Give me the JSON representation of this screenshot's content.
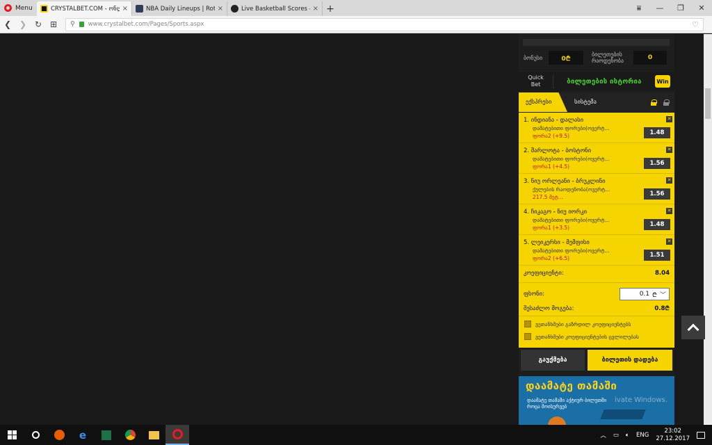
{
  "browser": {
    "menu_label": "Menu",
    "tabs": [
      {
        "title": "CRYSTALBET.COM - ონლაინ",
        "close": "×"
      },
      {
        "title": "NBA Daily Lineups | RotoWire",
        "close": "×"
      },
      {
        "title": "Live Basketball Scores - NBA",
        "close": "×"
      }
    ],
    "new_tab": "+",
    "url": "www.crystalbet.com/Pages/Sports.aspx"
  },
  "betslip": {
    "bonus_label": "ბონუსი",
    "bonus_value": "0₾",
    "tickets_label_1": "ბილეთების",
    "tickets_label_2": "რაოდენობა",
    "tickets_value": "0",
    "quick_bet_1": "Quick",
    "quick_bet_2": "Bet",
    "history_label": "ბილეთების ისტორია",
    "win_badge": "Win",
    "tab_express": "ექსპრესი",
    "tab_system": "სისტემა",
    "bets": [
      {
        "title": "1. ინდიანა - დალასი",
        "market": "დამატებითი ფორები(ოვერტ...",
        "pick": "ფორა2 (+9.5)",
        "odds": "1.48"
      },
      {
        "title": "2. შარლოტა - ბოსტონი",
        "market": "დამატებითი ფორები(ოვერტ...",
        "pick": "ფორა1 (+4.5)",
        "odds": "1.56"
      },
      {
        "title": "3. ნიუ ორლეანი - ბრუკლინი",
        "market": "ქულების რაოდენობა(ოვერტ...",
        "pick": "217.5 მეტ...",
        "odds": "1.56"
      },
      {
        "title": "4. ჩიკაგო - ნიუ იორკი",
        "market": "დამატებითი ფორები(ოვერტ...",
        "pick": "ფორა1 (+3.5)",
        "odds": "1.48"
      },
      {
        "title": "5. ლეიკერსი - მემფისი",
        "market": "დამატებითი ფორები(ოვერტ...",
        "pick": "ფორა2 (+6.5)",
        "odds": "1.51"
      }
    ],
    "coef_label": "კოეფიციენტი:",
    "coef_value": "8.04",
    "stake_label": "ფსონი:",
    "stake_value": "0.1",
    "stake_currency": "₾",
    "win_label": "შესაძლო მოგება:",
    "win_value": "0.8₾",
    "opt_1": "ვეთანხმები გაზრდილ კოეფიციენტებს",
    "opt_2": "ვეთანხმები კოეფიციენტების ცვლილებას",
    "btn_clear": "გაუქმება",
    "btn_place": "ბილეთის დადება"
  },
  "promo": {
    "title": "დაამატე თამაში",
    "sub_1": "დაამატე თამაში აქტიურ ბილეთში",
    "sub_2": "როცა მოისურვებ"
  },
  "overlay": {
    "watermark": "ivate Windows."
  },
  "taskbar": {
    "lang": "ENG",
    "time": "23:02",
    "date": "27.12.2017"
  },
  "colors": {
    "accent": "#f5d400",
    "history_green": "#49d12f",
    "pick_red": "#c41a1a"
  }
}
